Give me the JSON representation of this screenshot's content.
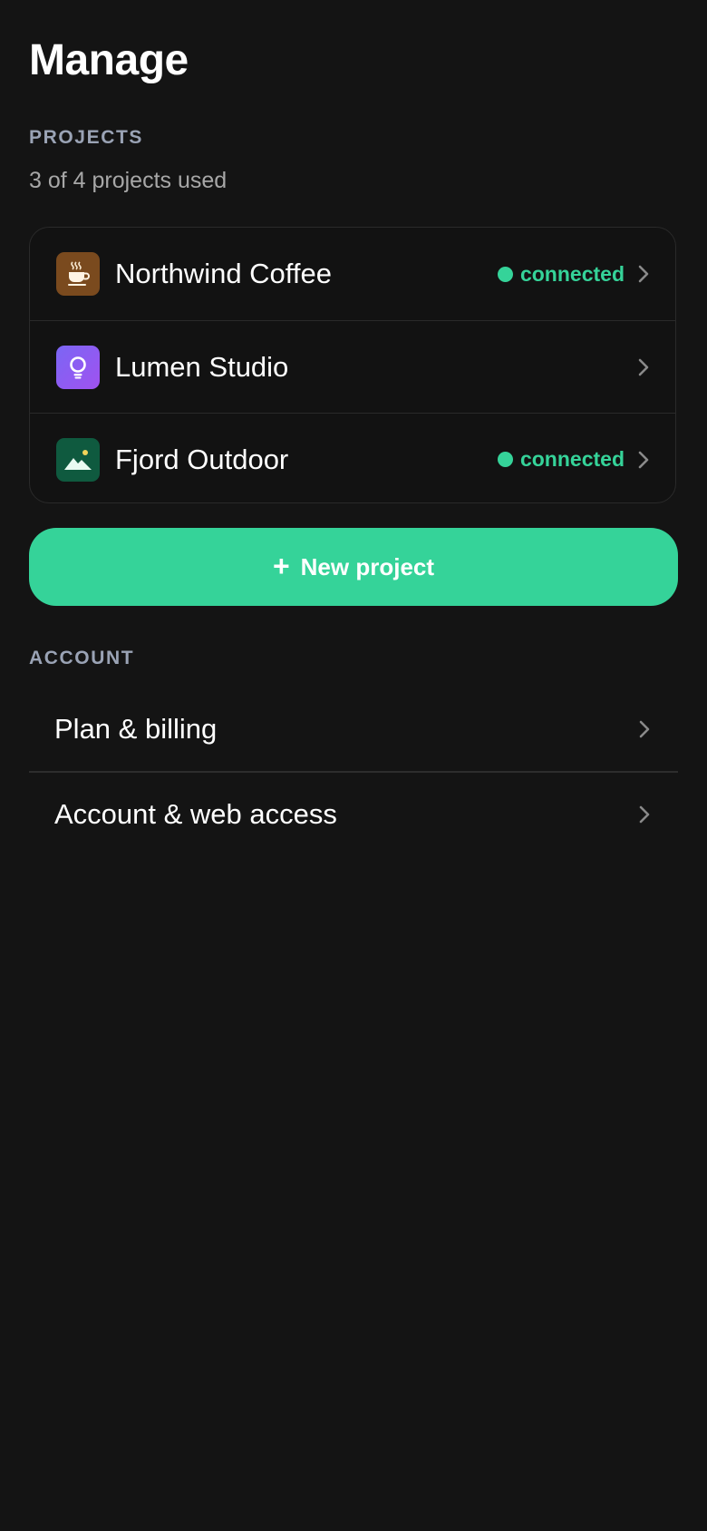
{
  "page": {
    "title": "Manage"
  },
  "projects": {
    "section_label": "PROJECTS",
    "usage_text": "3 of 4 projects used",
    "items": [
      {
        "name": "Northwind Coffee",
        "icon": "coffee-cup-icon",
        "icon_bg": "#7a4a1e",
        "status": "connected"
      },
      {
        "name": "Lumen Studio",
        "icon": "lightbulb-icon",
        "icon_bg": "#8b5cf6",
        "status": ""
      },
      {
        "name": "Fjord Outdoor",
        "icon": "mountain-icon",
        "icon_bg": "#0f5a3f",
        "status": "connected"
      }
    ],
    "new_button": {
      "icon": "plus-icon",
      "label": "New project"
    }
  },
  "account": {
    "section_label": "ACCOUNT",
    "items": [
      {
        "label": "Plan & billing"
      },
      {
        "label": "Account & web access"
      }
    ]
  },
  "colors": {
    "background": "#141414",
    "accent": "#35d399",
    "section_label": "#9aa3b5",
    "muted_text": "#a7a7a7",
    "chevron": "#8a8a8a"
  }
}
